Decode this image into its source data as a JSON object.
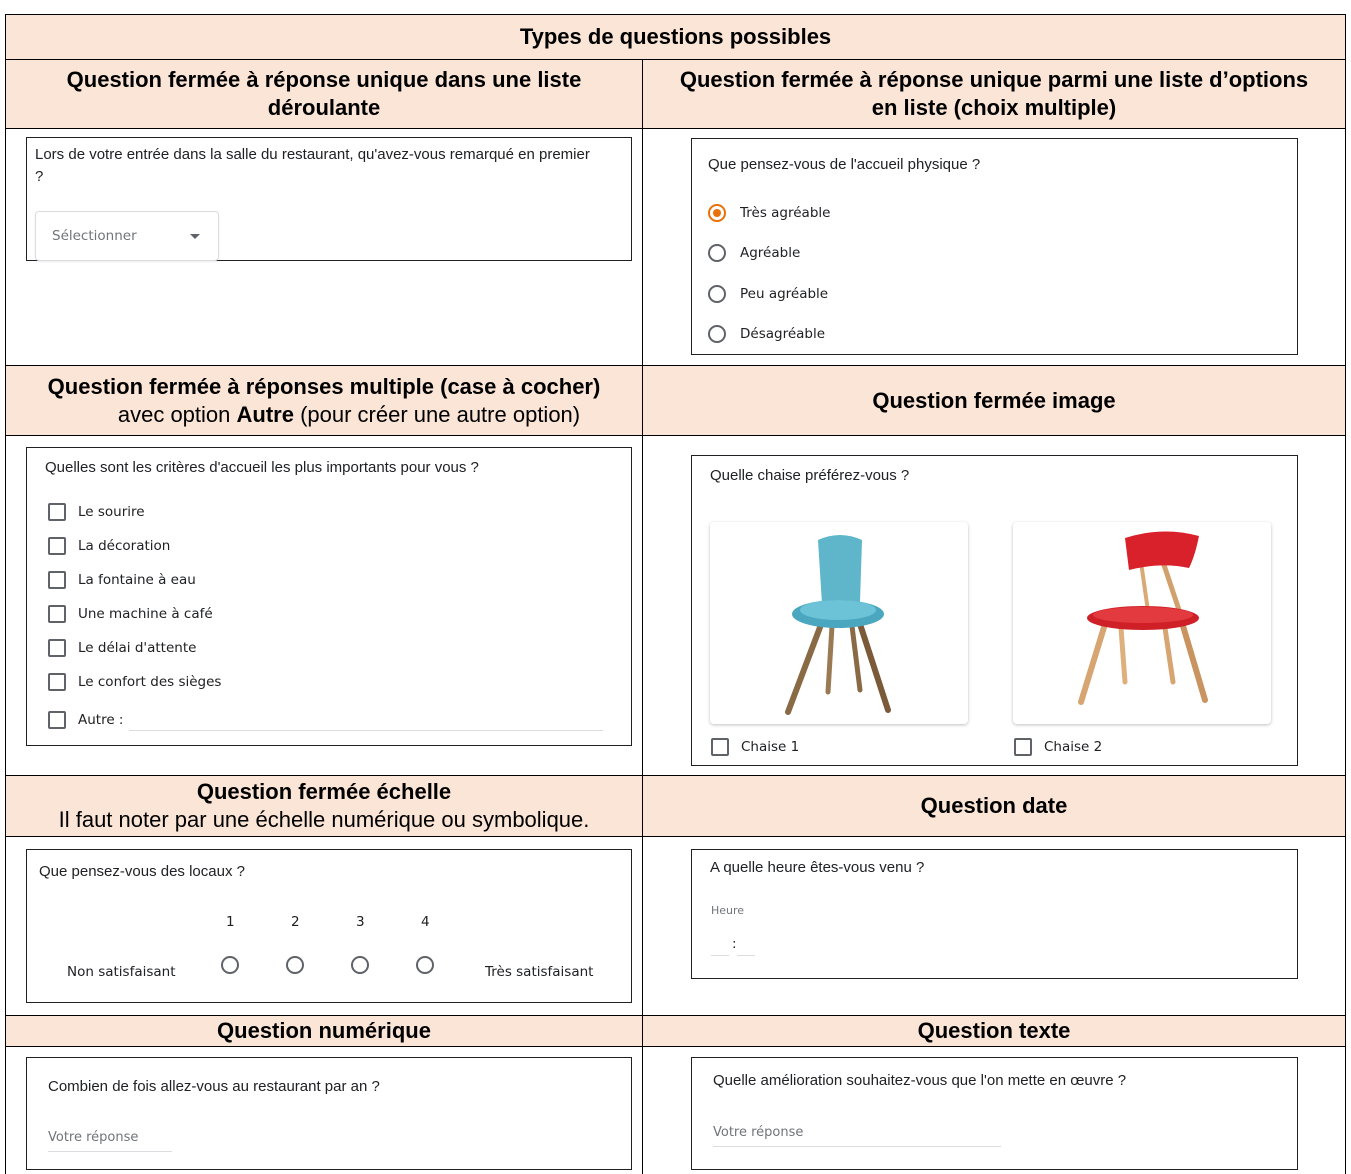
{
  "title": "Types de questions possibles",
  "sections": {
    "dropdown": {
      "header": "Question fermée à réponse unique dans une liste déroulante",
      "question": "Lors de votre entrée dans la salle du restaurant, qu'avez-vous remarqué en premier ?",
      "select_placeholder": "Sélectionner"
    },
    "radio": {
      "header": "Question fermée à réponse unique parmi une liste d’options en liste (choix multiple)",
      "question": "Que pensez-vous de l'accueil physique ?",
      "options": [
        "Très agréable",
        "Agréable",
        "Peu agréable",
        "Désagréable"
      ],
      "selected_index": 0,
      "accent": "#e8710a"
    },
    "checkbox": {
      "header_bold": "Question fermée à réponses multiple (case à cocher)",
      "header_prefix": "avec option ",
      "header_bold_word": "Autre",
      "header_suffix": " (pour créer une autre option)",
      "question": "Quelles sont les critères d'accueil les plus importants pour vous ?",
      "options": [
        "Le sourire",
        "La décoration",
        "La fontaine à eau",
        "Une machine à café",
        "Le délai d'attente",
        "Le confort des sièges"
      ],
      "other_label": "Autre :"
    },
    "image": {
      "header": "Question fermée image",
      "question": "Quelle chaise préférez-vous ?",
      "choices": [
        "Chaise 1",
        "Chaise 2"
      ]
    },
    "scale": {
      "header_bold": "Question fermée échelle",
      "header_plain": "Il faut noter par une échelle numérique ou symbolique.",
      "question": "Que pensez-vous des locaux ?",
      "levels": [
        "1",
        "2",
        "3",
        "4"
      ],
      "min_label": "Non satisfaisant",
      "max_label": "Très satisfaisant"
    },
    "date": {
      "header": "Question date",
      "question": "A quelle heure êtes-vous venu ?",
      "field_label": "Heure",
      "separator": ":"
    },
    "numeric": {
      "header": "Question numérique",
      "question": "Combien de fois allez-vous au restaurant par an ?",
      "placeholder": "Votre réponse"
    },
    "text": {
      "header": "Question texte",
      "question": "Quelle amélioration souhaitez-vous que l'on mette en œuvre ?",
      "placeholder": "Votre réponse"
    }
  }
}
